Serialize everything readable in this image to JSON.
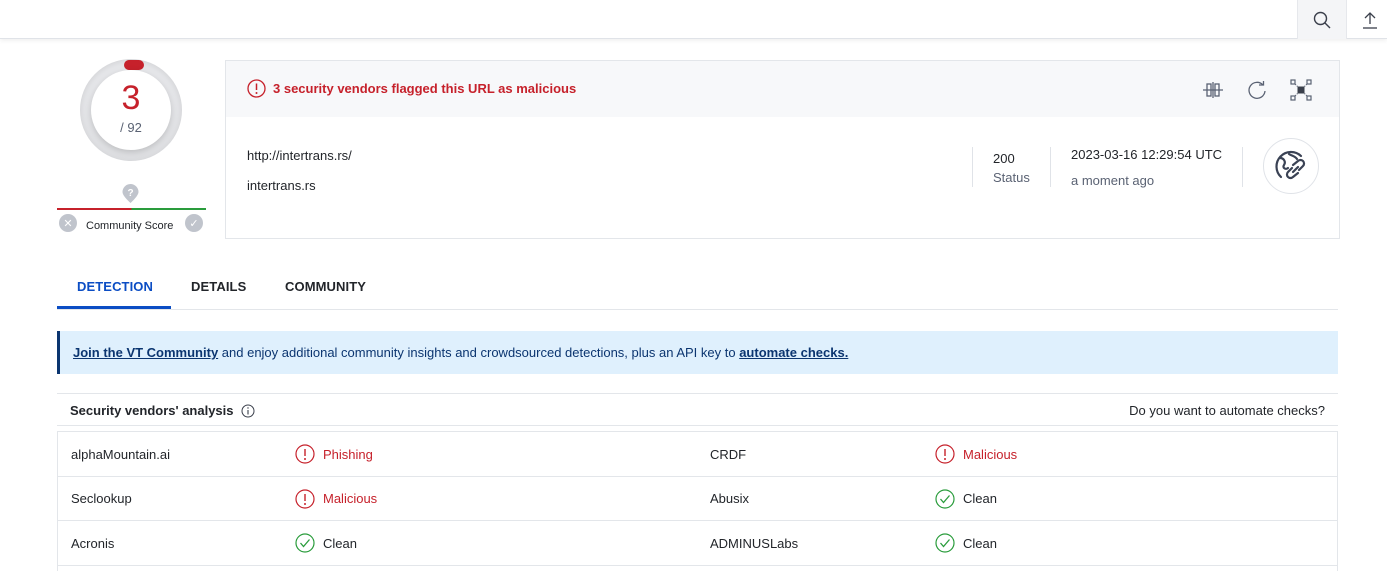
{
  "topbar": {
    "search_icon": "search-icon",
    "upload_icon": "upload-icon"
  },
  "score": {
    "detections": "3",
    "total": "/ 92",
    "detection_fraction": 0.0326,
    "color": "#c6212b"
  },
  "community": {
    "label": "Community Score",
    "unknown_icon": "question-pin-icon"
  },
  "summary": {
    "alert_text": "3 security vendors flagged this URL as malicious",
    "url": "http://intertrans.rs/",
    "domain": "intertrans.rs",
    "status_code": "200",
    "status_label": "Status",
    "date": "2023-03-16 12:29:54 UTC",
    "relative_time": "a moment ago",
    "actions": [
      "compare-icon",
      "reanalyze-icon",
      "graph-icon"
    ]
  },
  "tabs": [
    {
      "label": "DETECTION",
      "active": true
    },
    {
      "label": "DETAILS",
      "active": false
    },
    {
      "label": "COMMUNITY",
      "active": false
    }
  ],
  "banner": {
    "link1": "Join the VT Community",
    "text": " and enjoy additional community insights and crowdsourced detections, plus an API key to ",
    "link2": "automate checks."
  },
  "analysis": {
    "title": "Security vendors' analysis",
    "automate_prompt": "Do you want to automate checks?",
    "rows": [
      [
        {
          "vendor": "alphaMountain.ai",
          "result": "Phishing",
          "verdict": "malicious"
        },
        {
          "vendor": "CRDF",
          "result": "Malicious",
          "verdict": "malicious"
        }
      ],
      [
        {
          "vendor": "Seclookup",
          "result": "Malicious",
          "verdict": "malicious"
        },
        {
          "vendor": "Abusix",
          "result": "Clean",
          "verdict": "clean"
        }
      ],
      [
        {
          "vendor": "Acronis",
          "result": "Clean",
          "verdict": "clean"
        },
        {
          "vendor": "ADMINUSLabs",
          "result": "Clean",
          "verdict": "clean"
        }
      ]
    ]
  },
  "colors": {
    "malicious": "#c6212b",
    "clean": "#2a9c3c",
    "accent": "#0b4dc4"
  }
}
